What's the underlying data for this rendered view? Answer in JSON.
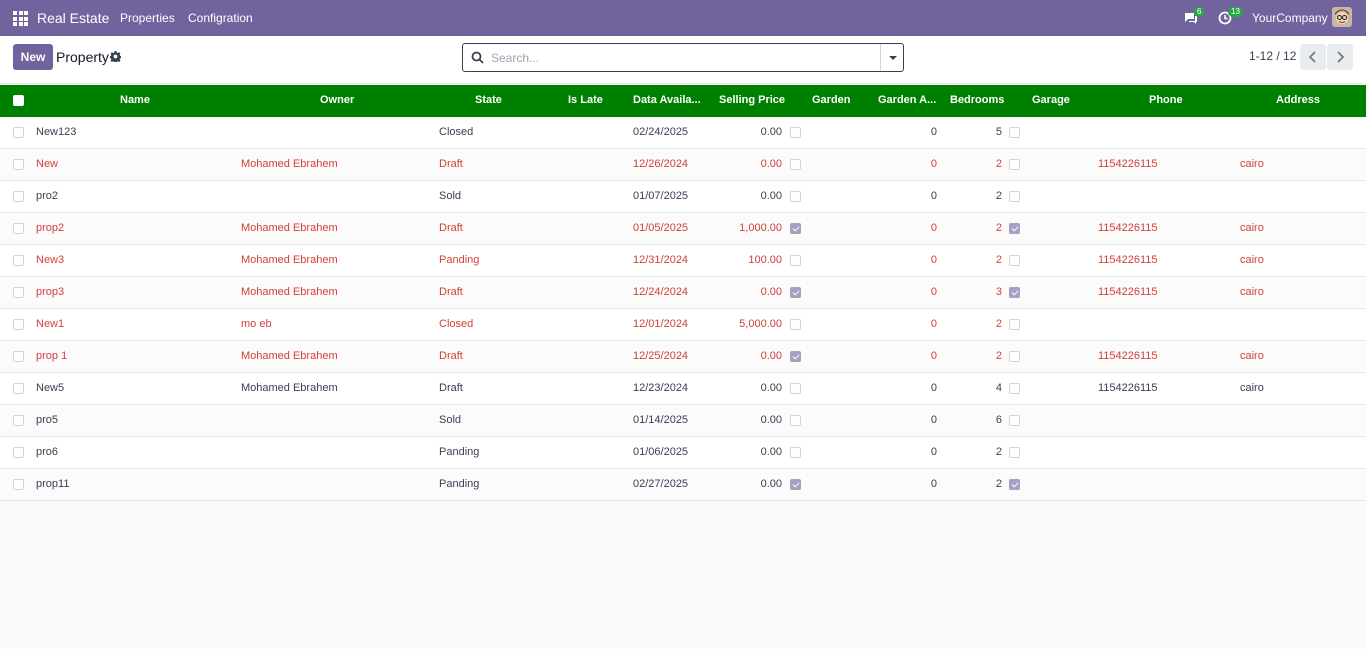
{
  "navbar": {
    "apps_icon": "grid-icon",
    "brand": "Real Estate",
    "menu": [
      "Properties",
      "Configration"
    ],
    "messages_count": "6",
    "activities_count": "13",
    "company": "YourCompany",
    "background": "#71639e"
  },
  "control_panel": {
    "new_label": "New",
    "breadcrumb": "Property",
    "search_placeholder": "Search...",
    "pager": "1-12 / 12"
  },
  "table": {
    "header_color": "#008000",
    "highlight_color": "#d23f3a",
    "columns": [
      "Name",
      "Owner",
      "State",
      "Is Late",
      "Data Availa...",
      "Selling Price",
      "Garden",
      "Garden A...",
      "Bedrooms",
      "Garage",
      "Phone",
      "Address"
    ],
    "rows": [
      {
        "name": "New123",
        "owner": "",
        "state": "Closed",
        "date": "02/24/2025",
        "price": "0.00",
        "garden": false,
        "garden_area": "0",
        "bedrooms": "5",
        "garage": false,
        "phone": "",
        "address": "",
        "highlight": false
      },
      {
        "name": "New",
        "owner": "Mohamed Ebrahem",
        "state": "Draft",
        "date": "12/26/2024",
        "price": "0.00",
        "garden": false,
        "garden_area": "0",
        "bedrooms": "2",
        "garage": false,
        "phone": "1154226115",
        "address": "cairo",
        "highlight": true
      },
      {
        "name": "pro2",
        "owner": "",
        "state": "Sold",
        "date": "01/07/2025",
        "price": "0.00",
        "garden": false,
        "garden_area": "0",
        "bedrooms": "2",
        "garage": false,
        "phone": "",
        "address": "",
        "highlight": false
      },
      {
        "name": "prop2",
        "owner": "Mohamed Ebrahem",
        "state": "Draft",
        "date": "01/05/2025",
        "price": "1,000.00",
        "garden": true,
        "garden_area": "0",
        "bedrooms": "2",
        "garage": true,
        "phone": "1154226115",
        "address": "cairo",
        "highlight": true
      },
      {
        "name": "New3",
        "owner": "Mohamed Ebrahem",
        "state": "Panding",
        "date": "12/31/2024",
        "price": "100.00",
        "garden": false,
        "garden_area": "0",
        "bedrooms": "2",
        "garage": false,
        "phone": "1154226115",
        "address": "cairo",
        "highlight": true
      },
      {
        "name": "prop3",
        "owner": "Mohamed Ebrahem",
        "state": "Draft",
        "date": "12/24/2024",
        "price": "0.00",
        "garden": true,
        "garden_area": "0",
        "bedrooms": "3",
        "garage": true,
        "phone": "1154226115",
        "address": "cairo",
        "highlight": true
      },
      {
        "name": "New1",
        "owner": "mo eb",
        "state": "Closed",
        "date": "12/01/2024",
        "price": "5,000.00",
        "garden": false,
        "garden_area": "0",
        "bedrooms": "2",
        "garage": false,
        "phone": "",
        "address": "",
        "highlight": true
      },
      {
        "name": "prop 1",
        "owner": "Mohamed Ebrahem",
        "state": "Draft",
        "date": "12/25/2024",
        "price": "0.00",
        "garden": true,
        "garden_area": "0",
        "bedrooms": "2",
        "garage": false,
        "phone": "1154226115",
        "address": "cairo",
        "highlight": true
      },
      {
        "name": "New5",
        "owner": "Mohamed Ebrahem",
        "state": "Draft",
        "date": "12/23/2024",
        "price": "0.00",
        "garden": false,
        "garden_area": "0",
        "bedrooms": "4",
        "garage": false,
        "phone": "1154226115",
        "address": "cairo",
        "highlight": false
      },
      {
        "name": "pro5",
        "owner": "",
        "state": "Sold",
        "date": "01/14/2025",
        "price": "0.00",
        "garden": false,
        "garden_area": "0",
        "bedrooms": "6",
        "garage": false,
        "phone": "",
        "address": "",
        "highlight": false
      },
      {
        "name": "pro6",
        "owner": "",
        "state": "Panding",
        "date": "01/06/2025",
        "price": "0.00",
        "garden": false,
        "garden_area": "0",
        "bedrooms": "2",
        "garage": false,
        "phone": "",
        "address": "",
        "highlight": false
      },
      {
        "name": "prop11",
        "owner": "",
        "state": "Panding",
        "date": "02/27/2025",
        "price": "0.00",
        "garden": true,
        "garden_area": "0",
        "bedrooms": "2",
        "garage": true,
        "phone": "",
        "address": "",
        "highlight": false
      }
    ]
  }
}
